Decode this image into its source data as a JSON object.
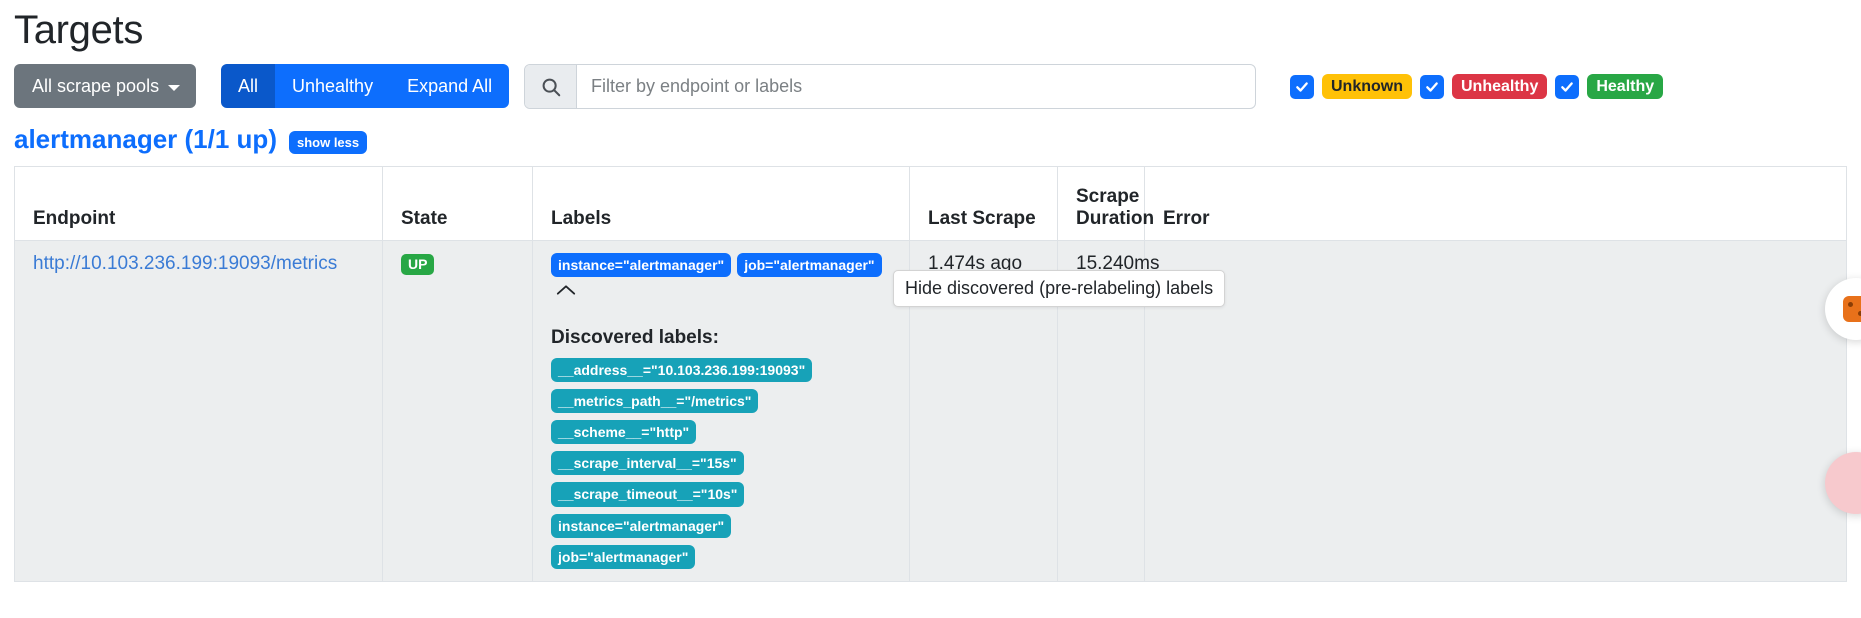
{
  "header": {
    "title": "Targets"
  },
  "toolbar": {
    "pool_dropdown_label": "All scrape pools",
    "filter_buttons": [
      {
        "label": "All",
        "active": true
      },
      {
        "label": "Unhealthy",
        "active": false
      },
      {
        "label": "Expand All",
        "active": false
      }
    ],
    "search": {
      "placeholder": "Filter by endpoint or labels",
      "value": "",
      "icon": "search-icon"
    }
  },
  "status_filters": [
    {
      "label": "Unknown",
      "checked": true,
      "bg": "#ffc107",
      "fg": "#212529"
    },
    {
      "label": "Unhealthy",
      "checked": true,
      "bg": "#dc3545",
      "fg": "#ffffff"
    },
    {
      "label": "Healthy",
      "checked": true,
      "bg": "#28a745",
      "fg": "#ffffff"
    }
  ],
  "scrape_pool": {
    "heading": "alertmanager (1/1 up)",
    "toggle_label": "show less"
  },
  "table": {
    "columns": [
      "Endpoint",
      "State",
      "Labels",
      "Last Scrape",
      "Scrape Duration",
      "Error"
    ],
    "rows": [
      {
        "endpoint": "http://10.103.236.199:19093/metrics",
        "state": "UP",
        "labels": [
          "instance=\"alertmanager\"",
          "job=\"alertmanager\""
        ],
        "collapse_icon": "chevron-up-icon",
        "last_scrape": "1.474s ago",
        "scrape_duration": "15.240ms",
        "error": "",
        "discovered": {
          "title": "Discovered labels:",
          "labels": [
            "__address__=\"10.103.236.199:19093\"",
            "__metrics_path__=\"/metrics\"",
            "__scheme__=\"http\"",
            "__scrape_interval__=\"15s\"",
            "__scrape_timeout__=\"10s\"",
            "instance=\"alertmanager\"",
            "job=\"alertmanager\""
          ]
        }
      }
    ]
  },
  "tooltip": {
    "text": "Hide discovered (pre-relabeling) labels"
  },
  "colors": {
    "primary": "#0d6efd",
    "primary_active": "#0a58ca",
    "secondary": "#6c757d",
    "success": "#28a745",
    "danger": "#dc3545",
    "warning": "#ffc107",
    "info": "#17a2b8",
    "link": "#3a7bd5",
    "row_bg": "#eceeef"
  }
}
